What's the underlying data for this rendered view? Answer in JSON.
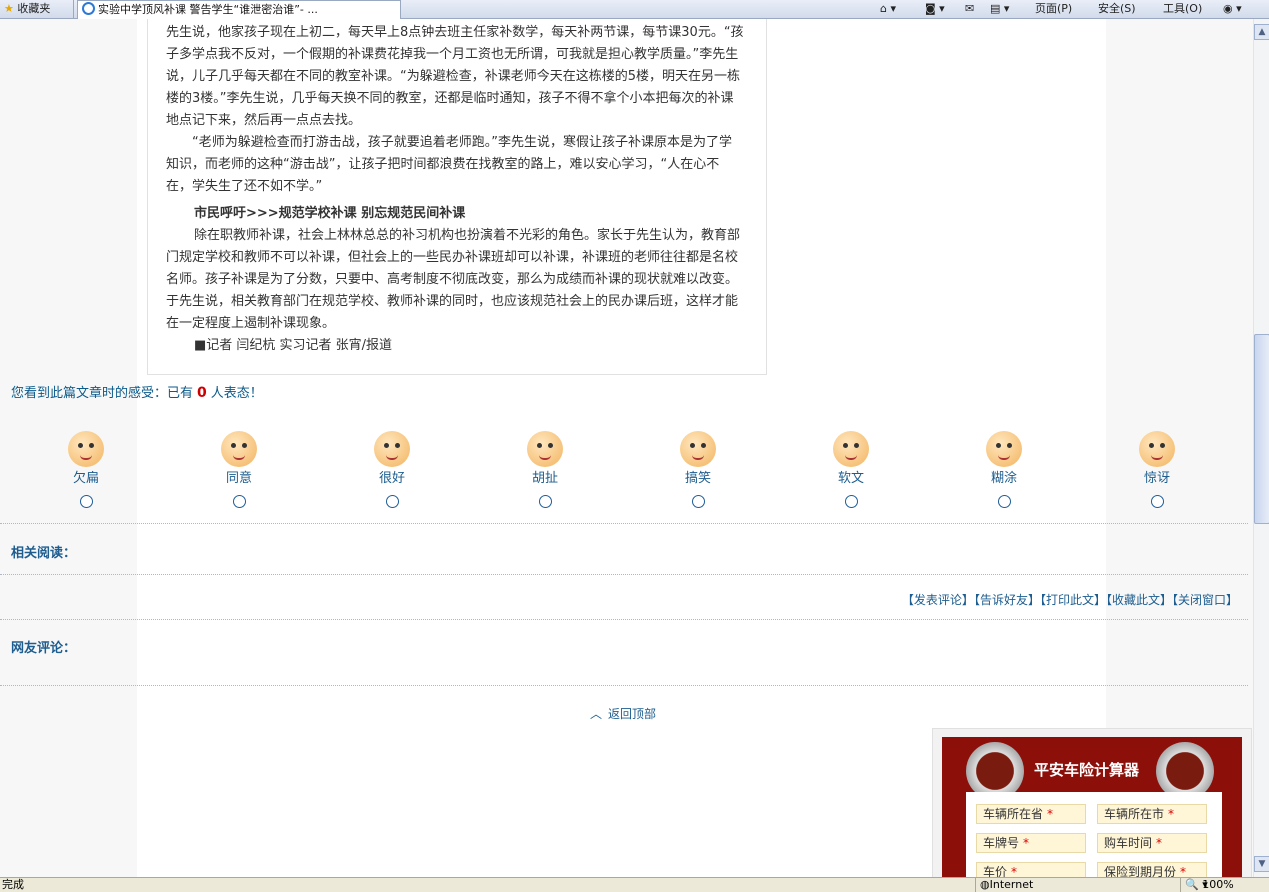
{
  "browser": {
    "favorites_label": "收藏夹",
    "tab_title": "实验中学顶风补课 警告学生“谁泄密治谁”- ...",
    "commands": [
      "页面(P)",
      "安全(S)",
      "工具(O)"
    ]
  },
  "article": {
    "paragraphs": [
      "先生说，他家孩子现在上初二，每天早上8点钟去班主任家补数学，每天补两节课，每节课30元。“孩子多学点我不反对，一个假期的补课费花掉我一个月工资也无所谓，可我就是担心教学质量。”李先生说，儿子几乎每天都在不同的教室补课。“为躲避检查，补课老师今天在这栋楼的5楼，明天在另一栋楼的3楼。”李先生说，几乎每天换不同的教室，还都是临时通知，孩子不得不拿个小本把每次的补课地点记下来，然后再一点点去找。",
      "“老师为躲避检查而打游击战，孩子就要追着老师跑。”李先生说，寒假让孩子补课原本是为了学知识，而老师的这种“游击战”，让孩子把时间都浪费在找教室的路上，难以安心学习，“人在心不在，学失生了还不如不学。”"
    ],
    "subheading": "市民呼吁>>>规范学校补课  别忘规范民间补课",
    "paragraph3": "除在职教师补课，社会上林林总总的补习机构也扮演着不光彩的角色。家长于先生认为，教育部门规定学校和教师不可以补课，但社会上的一些民办补课班却可以补课，补课班的老师往往都是名校名师。孩子补课是为了分数，只要中、高考制度不彻底改变，那么为成绩而补课的现状就难以改变。于先生说，相关教育部门在规范学校、教师补课的同时，也应该规范社会上的民办课后班，这样才能在一定程度上遏制补课现象。",
    "byline": "■记者 闫纪杭 实习记者 张宵/报道"
  },
  "poll": {
    "question_prefix": "您看到此篇文章时的感受：已有",
    "count": "0",
    "question_suffix": "人表态！",
    "moods": [
      "欠扁",
      "同意",
      "很好",
      "胡扯",
      "搞笑",
      "软文",
      "糊涂",
      "惊讶"
    ]
  },
  "related_label": "相关阅读：",
  "actions": [
    "【发表评论】",
    "【告诉好友】",
    "【打印此文】",
    "【收藏此文】",
    "【关闭窗口】"
  ],
  "comments_label": "网友评论：",
  "back_to_top": "返回顶部",
  "ad": {
    "title": "平安车险计算器",
    "fields": [
      "车辆所在省",
      "车辆所在市",
      "车牌号",
      "购车时间",
      "车价",
      "保险到期月份"
    ]
  },
  "statusbar": {
    "left": "完成",
    "zone": "Internet",
    "zoom": "100%"
  }
}
